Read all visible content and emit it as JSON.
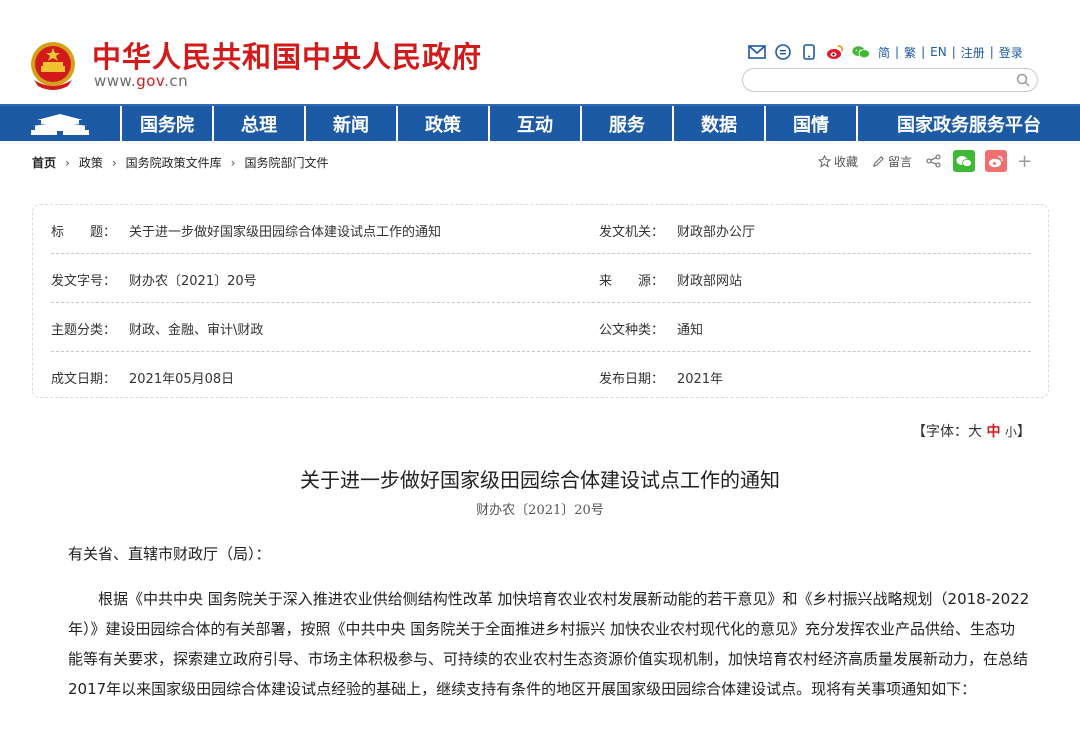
{
  "header": {
    "site_title": "中华人民共和国中央人民政府",
    "site_url_prefix": "www.",
    "site_url_brand": "gov",
    "site_url_suffix": ".cn",
    "brand_color": "#d21a1a",
    "links": [
      "简",
      "繁",
      "EN",
      "注册",
      "登录"
    ],
    "social_icons": [
      "mail-icon",
      "message-icon",
      "mobile-icon",
      "weibo-icon",
      "wechat-icon"
    ]
  },
  "nav": {
    "color": "#1d5aa5",
    "items": [
      "国务院",
      "总理",
      "新闻",
      "政策",
      "互动",
      "服务",
      "数据",
      "国情",
      "国家政务服务平台"
    ]
  },
  "breadcrumb": [
    "首页",
    "政策",
    "国务院政策文件库",
    "国务院部门文件"
  ],
  "tools": {
    "favorite": "收藏",
    "comment": "留言"
  },
  "info": {
    "title_label": "标　　题：",
    "title_value": "关于进一步做好国家级田园综合体建设试点工作的通知",
    "issuer_label": "发文机关：",
    "issuer_value": "财政部办公厅",
    "docno_label": "发文字号：",
    "docno_value": "财办农〔2021〕20号",
    "source_label": "来　　源：",
    "source_value": "财政部网站",
    "topic_label": "主题分类：",
    "topic_value": "财政、金融、审计\\财政",
    "type_label": "公文种类：",
    "type_value": "通知",
    "date_label": "成文日期：",
    "date_value": "2021年05月08日",
    "pub_label": "发布日期：",
    "pub_value": "2021年"
  },
  "fontsize": {
    "prefix": "【字体：",
    "big": "大",
    "mid": "中",
    "small": "小",
    "suffix": "】"
  },
  "article": {
    "title": "关于进一步做好国家级田园综合体建设试点工作的通知",
    "docno": "财办农〔2021〕20号",
    "greeting": "有关省、直辖市财政厅（局）：",
    "paragraph": "根据《中共中央 国务院关于深入推进农业供给侧结构性改革 加快培育农业农村发展新动能的若干意见》和《乡村振兴战略规划（2018-2022年）》建设田园综合体的有关部署，按照《中共中央 国务院关于全面推进乡村振兴 加快农业农村现代化的意见》充分发挥农业产品供给、生态功能等有关要求，探索建立政府引导、市场主体积极参与、可持续的农业农村生态资源价值实现机制，加快培育农村经济高质量发展新动力，在总结2017年以来国家级田园综合体建设试点经验的基础上，继续支持有条件的地区开展国家级田园综合体建设试点。现将有关事项通知如下："
  }
}
